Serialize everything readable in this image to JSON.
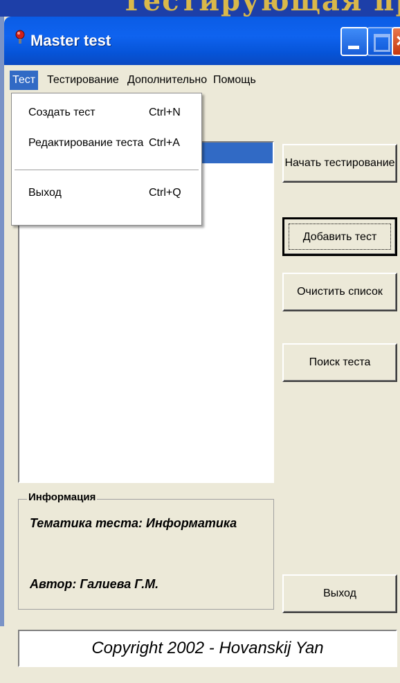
{
  "background": {
    "slide_text": "Тестирующая программа"
  },
  "window": {
    "title": "Master test"
  },
  "menu": {
    "items": [
      {
        "label": "Тест"
      },
      {
        "label": "Тестирование"
      },
      {
        "label": "Дополнительно"
      },
      {
        "label": "Помощь"
      }
    ]
  },
  "dropdown": {
    "items": [
      {
        "label": "Создать тест",
        "shortcut": "Ctrl+N"
      },
      {
        "label": "Редактирование теста",
        "shortcut": "Ctrl+A"
      },
      {
        "label": "Выход",
        "shortcut": "Ctrl+Q"
      }
    ]
  },
  "buttons": {
    "start_testing": "Начать тестирование",
    "add_test": "Добавить тест",
    "clear_list": "Очистить список",
    "find_test": "Поиск теста",
    "exit": "Выход"
  },
  "info": {
    "legend": "Информация",
    "topic": "Тематика теста: Информатика",
    "author": "Автор: Галиева Г.М."
  },
  "footer": {
    "copyright": "Copyright 2002 - Hovanskij Yan"
  },
  "colors": {
    "titlebar": "#0a5ce5",
    "selection": "#316ac5",
    "window_bg": "#ece9d8",
    "close_button": "#c6380f"
  }
}
